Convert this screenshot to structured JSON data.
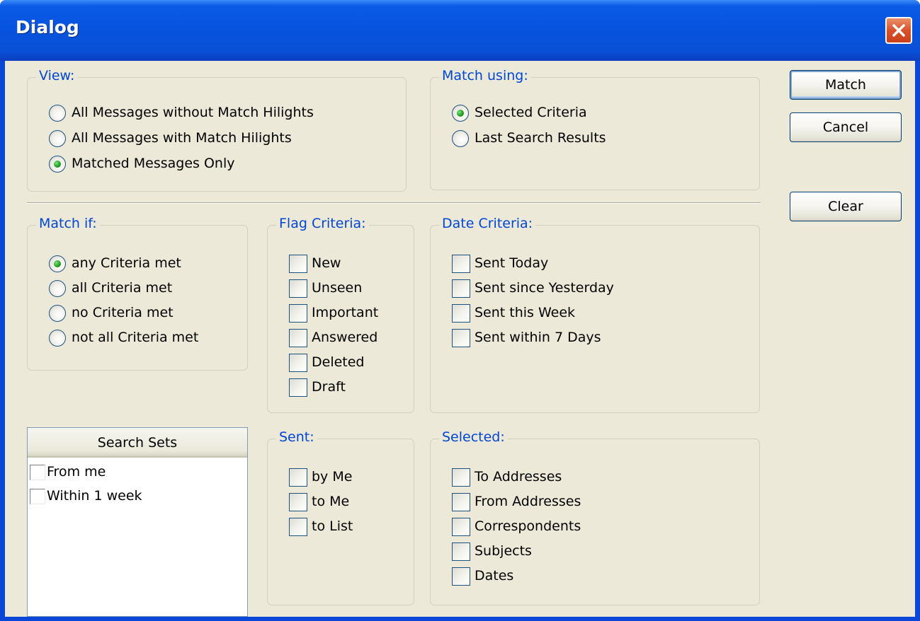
{
  "window": {
    "title": "Dialog"
  },
  "buttons": {
    "match": "Match",
    "cancel": "Cancel",
    "clear": "Clear"
  },
  "view": {
    "label": "View:",
    "options": [
      {
        "label": "All Messages without Match Hilights",
        "checked": false
      },
      {
        "label": "All Messages with Match Hilights",
        "checked": false
      },
      {
        "label": "Matched Messages Only",
        "checked": true
      }
    ]
  },
  "match_using": {
    "label": "Match using:",
    "options": [
      {
        "label": "Selected Criteria",
        "checked": true
      },
      {
        "label": "Last Search Results",
        "checked": false
      }
    ]
  },
  "match_if": {
    "label": "Match if:",
    "options": [
      {
        "label": "any Criteria met",
        "checked": true
      },
      {
        "label": "all Criteria met",
        "checked": false
      },
      {
        "label": "no Criteria met",
        "checked": false
      },
      {
        "label": "not all Criteria met",
        "checked": false
      }
    ]
  },
  "flag_criteria": {
    "label": "Flag Criteria:",
    "items": [
      {
        "label": "New",
        "checked": false
      },
      {
        "label": "Unseen",
        "checked": false
      },
      {
        "label": "Important",
        "checked": false
      },
      {
        "label": "Answered",
        "checked": false
      },
      {
        "label": "Deleted",
        "checked": false
      },
      {
        "label": "Draft",
        "checked": false
      }
    ]
  },
  "date_criteria": {
    "label": "Date Criteria:",
    "items": [
      {
        "label": "Sent Today",
        "checked": false
      },
      {
        "label": "Sent since Yesterday",
        "checked": false
      },
      {
        "label": "Sent this Week",
        "checked": false
      },
      {
        "label": "Sent within 7 Days",
        "checked": false
      }
    ]
  },
  "search_sets": {
    "header": "Search Sets",
    "items": [
      {
        "label": "From me",
        "checked": false
      },
      {
        "label": "Within 1 week",
        "checked": false
      }
    ]
  },
  "sent": {
    "label": "Sent:",
    "items": [
      {
        "label": "by Me",
        "checked": false
      },
      {
        "label": "to Me",
        "checked": false
      },
      {
        "label": "to List",
        "checked": false
      }
    ]
  },
  "selected": {
    "label": "Selected:",
    "items": [
      {
        "label": "To Addresses",
        "checked": false
      },
      {
        "label": "From Addresses",
        "checked": false
      },
      {
        "label": "Correspondents",
        "checked": false
      },
      {
        "label": "Subjects",
        "checked": false
      },
      {
        "label": "Dates",
        "checked": false
      }
    ]
  }
}
